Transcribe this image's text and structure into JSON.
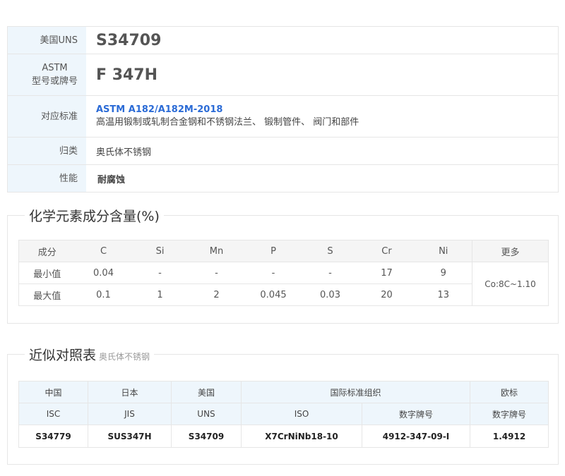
{
  "info": {
    "uns_label": "美国UNS",
    "uns_value": "S34709",
    "astm_label_1": "ASTM",
    "astm_label_2": "型号或牌号",
    "astm_value": "F 347H",
    "std_label": "对应标准",
    "std_link": "ASTM A182/A182M-2018",
    "std_desc": "高温用锻制或轧制合金钢和不锈钢法兰、 锻制管件、 阀门和部件",
    "cls_label": "归类",
    "cls_value": "奥氏体不锈钢",
    "perf_label": "性能",
    "perf_value": "耐腐蚀"
  },
  "chem": {
    "title": "化学元素成分含量(%)",
    "headers": [
      "成分",
      "C",
      "Si",
      "Mn",
      "P",
      "S",
      "Cr",
      "Ni",
      "更多"
    ],
    "rows": [
      {
        "label": "最小值",
        "values": [
          "0.04",
          "-",
          "-",
          "-",
          "-",
          "17",
          "9"
        ]
      },
      {
        "label": "最大值",
        "values": [
          "0.1",
          "1",
          "2",
          "0.045",
          "0.03",
          "20",
          "13"
        ]
      }
    ],
    "more": "Co:8C~1.10"
  },
  "comp": {
    "title": "近似对照表",
    "subtitle": "奥氏体不锈钢",
    "group_headers": [
      "中国",
      "日本",
      "美国",
      "国际标准组织",
      "欧标"
    ],
    "sub_headers": [
      "ISC",
      "JIS",
      "UNS",
      "ISO",
      "数字牌号",
      "数字牌号"
    ],
    "row": [
      "S34779",
      "SUS347H",
      "S34709",
      "X7CrNiNb18-10",
      "4912-347-09-I",
      "1.4912"
    ]
  }
}
